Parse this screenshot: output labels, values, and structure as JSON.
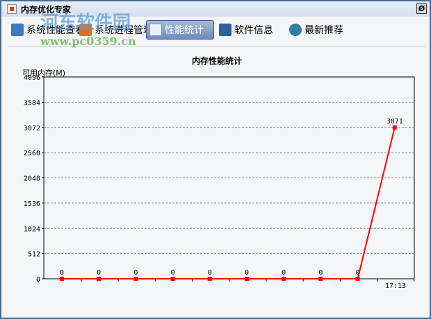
{
  "window": {
    "title": "内存优化专家",
    "close_icon": "close-icon"
  },
  "watermark": {
    "text": "河东软件园",
    "url": "www.pc0359.cn"
  },
  "tabs": [
    {
      "label": "系统性能查看",
      "icon": "monitor-icon",
      "color": "#3a7ac0"
    },
    {
      "label": "系统进程管理",
      "icon": "window-icon",
      "color": "#e07020"
    },
    {
      "label": "性能统计",
      "icon": "magnifier-icon",
      "color": "#5aa0d0",
      "active": true
    },
    {
      "label": "软件信息",
      "icon": "info-icon",
      "color": "#2a60a0"
    },
    {
      "label": "最新推荐",
      "icon": "gear-icon",
      "color": "#3080a0"
    }
  ],
  "chart_data": {
    "type": "line",
    "title": "内存性能统计",
    "ylabel": "可用内存(M)",
    "ylim": [
      0,
      4096
    ],
    "yticks": [
      "0",
      "512",
      "1024",
      "1536",
      "2048",
      "2560",
      "3072",
      "3584",
      "4096"
    ],
    "x_label_last": "17:13",
    "values": [
      0,
      0,
      0,
      0,
      0,
      0,
      0,
      0,
      0,
      3071
    ],
    "labels": [
      "0",
      "0",
      "0",
      "0",
      "0",
      "0",
      "0",
      "0",
      "0",
      "3071"
    ],
    "color": "#ff0000",
    "grid": true
  }
}
